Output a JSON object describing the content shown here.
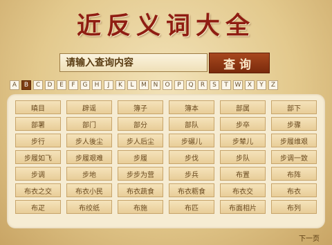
{
  "title": "近反义词大全",
  "search": {
    "placeholder": "请输入查询内容",
    "button_label": "查询"
  },
  "letters": [
    "A",
    "B",
    "C",
    "D",
    "E",
    "F",
    "G",
    "H",
    "J",
    "K",
    "L",
    "M",
    "N",
    "O",
    "P",
    "Q",
    "R",
    "S",
    "T",
    "W",
    "X",
    "Y",
    "Z"
  ],
  "active_letter": "B",
  "words": [
    "瞋目",
    "辟谣",
    "簿子",
    "簿本",
    "部属",
    "部下",
    "部署",
    "部门",
    "部分",
    "部队",
    "步卒",
    "步骤",
    "步行",
    "步人後尘",
    "步人后尘",
    "步碾儿",
    "步辇儿",
    "步履维艰",
    "步履如飞",
    "步履艰难",
    "步履",
    "步伐",
    "步队",
    "步调一致",
    "步调",
    "步地",
    "步步为营",
    "步兵",
    "布置",
    "布阵",
    "布衣之交",
    "布衣小民",
    "布衣蔬食",
    "布衣粝食",
    "布衣交",
    "布衣",
    "布疋",
    "布绞纸",
    "布施",
    "布匹",
    "布面相片",
    "布列"
  ],
  "pagination": {
    "next_label": "下一页"
  }
}
